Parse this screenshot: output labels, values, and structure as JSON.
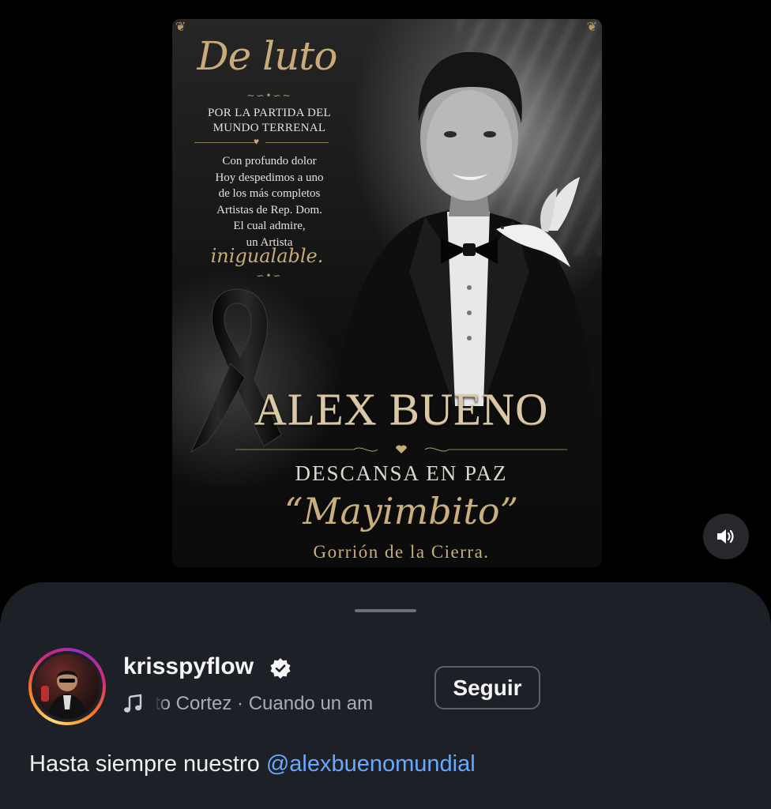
{
  "poster": {
    "heading_script": "De luto",
    "subtitle": "POR LA PARTIDA DEL MUNDO TERRENAL",
    "message_lines": [
      "Con profundo dolor",
      "Hoy despedimos a uno",
      "de los más completos",
      "Artistas de Rep. Dom.",
      "El cual admire,",
      "un Artista"
    ],
    "emphasis_script": "inigualable.",
    "name": "ALEX BUENO",
    "rip": "DESCANSA EN PAZ",
    "nickname": "“Mayimbito”",
    "alias": "Gorrión de la Cierra.",
    "accent_color": "#c9ae7e"
  },
  "controls": {
    "volume_icon": "speaker-volume-icon"
  },
  "post": {
    "username": "krisspyflow",
    "verified": true,
    "music_icon": "music-note-icon",
    "music_text": "to Cortez · Cuando un am",
    "follow_label": "Seguir",
    "caption_text": "Hasta siempre nuestro ",
    "caption_mention": "@alexbuenomundial",
    "mention_color": "#6aa8ff"
  }
}
